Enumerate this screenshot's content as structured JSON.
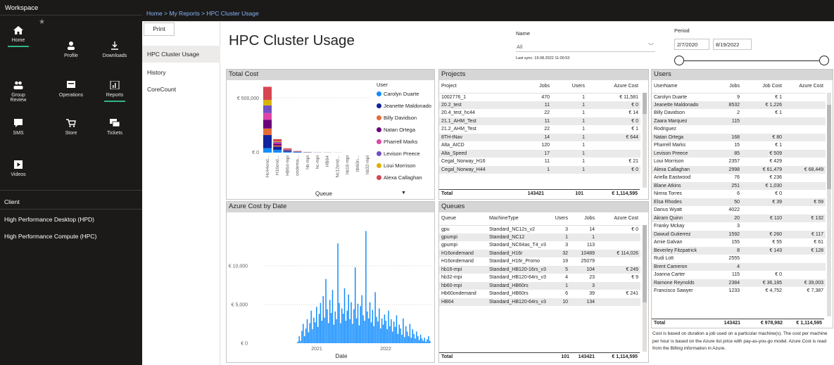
{
  "rail": {
    "workspace_title": "Workspace",
    "nav": [
      {
        "label": "Home",
        "icon": "home-icon"
      },
      {
        "label": "Profile",
        "icon": "person-icon"
      },
      {
        "label": "Downloads",
        "icon": "download-icon"
      },
      {
        "label": "Group Review",
        "icon": "group-icon"
      },
      {
        "label": "Operations",
        "icon": "operations-icon"
      },
      {
        "label": "Reports",
        "icon": "report-icon"
      },
      {
        "label": "SMS",
        "icon": "sms-icon"
      },
      {
        "label": "Store",
        "icon": "cart-icon"
      },
      {
        "label": "Tickets",
        "icon": "ticket-icon"
      },
      {
        "label": "Videos",
        "icon": "video-icon"
      }
    ],
    "section_label": "Client",
    "links": [
      "High Performance Desktop (HPD)",
      "High Performance Compute (HPC)"
    ]
  },
  "breadcrumb": "Home > My Reports > HPC Cluster Usage",
  "pages": {
    "print_label": "Print",
    "items": [
      "HPC Cluster Usage",
      "History",
      "CoreCount"
    ]
  },
  "report": {
    "title": "HPC Cluster Usage",
    "name_label": "Name",
    "name_value": "All",
    "last_sync": "Last sync: 19.08.2022 11:00:53",
    "period_label": "Period",
    "period_start": "2/7/2020",
    "period_end": "8/19/2022"
  },
  "total_cost": {
    "title": "Total Cost",
    "legend_title": "User",
    "legend": [
      {
        "name": "Carolyn Duarte",
        "color": "#118dff"
      },
      {
        "name": "Jeanette Maldonado",
        "color": "#12239e"
      },
      {
        "name": "Billy Davidson",
        "color": "#e66c37"
      },
      {
        "name": "Natan Ortega",
        "color": "#6b007b"
      },
      {
        "name": "Pharrell Marks",
        "color": "#e044a7"
      },
      {
        "name": "Levison Preece",
        "color": "#744ec2"
      },
      {
        "name": "Loui Morrison",
        "color": "#d9b300"
      },
      {
        "name": "Alexa Callaghan",
        "color": "#d64550"
      }
    ],
    "xlabel": "Queue",
    "ytick_top": "€ 500,000",
    "ytick_zero": "€ 0"
  },
  "azure_by_date": {
    "title": "Azure Cost by Date",
    "xlabel": "Date",
    "yticks": [
      "€ 10,000",
      "€ 5,000",
      "€ 0"
    ],
    "xticks": [
      "2021",
      "2022"
    ]
  },
  "projects": {
    "title": "Projects",
    "headers": [
      "Project",
      "Jobs",
      "Users",
      "Azure Cost"
    ],
    "rows": [
      [
        "1002776_1",
        "470",
        "1",
        "€ 11,581"
      ],
      [
        "20.2_test",
        "11",
        "1",
        "€ 0"
      ],
      [
        "20.4_test_hc44",
        "22",
        "1",
        "€ 14"
      ],
      [
        "21.1_AHM_Test",
        "11",
        "1",
        "€ 0"
      ],
      [
        "21.2_AHM_Test",
        "22",
        "1",
        "€ 1"
      ],
      [
        "8TH-tNav",
        "14",
        "1",
        "€ 644"
      ],
      [
        "Alta_AICD",
        "120",
        "1",
        ""
      ],
      [
        "Alta_Speed",
        "17",
        "1",
        ""
      ],
      [
        "Cegal_Norway_H16",
        "11",
        "1",
        "€ 21"
      ],
      [
        "Cegal_Norway_H44",
        "1",
        "1",
        "€ 0"
      ]
    ],
    "total": [
      "Total",
      "143421",
      "101",
      "€ 1,114,595"
    ]
  },
  "queues": {
    "title": "Queues",
    "headers": [
      "Queue",
      "MachineType",
      "Users",
      "Jobs",
      "Azure Cost"
    ],
    "rows": [
      [
        "gpu",
        "Standard_NC12s_v2",
        "3",
        "14",
        "€ 0"
      ],
      [
        "gpumpi",
        "Standard_NC12",
        "1",
        "1",
        ""
      ],
      [
        "gpumpi",
        "Standard_NC64as_T4_v3",
        "3",
        "113",
        ""
      ],
      [
        "H16ondemand",
        "Standard_H16r",
        "32",
        "10489",
        "€ 114,026"
      ],
      [
        "H16ondemand",
        "Standard_H16r_Promo",
        "19",
        "25079",
        ""
      ],
      [
        "hb16-mpi",
        "Standard_HB120-16rs_v3",
        "5",
        "104",
        "€ 249"
      ],
      [
        "hb32-mpi",
        "Standard_HB120-64rs_v3",
        "4",
        "23",
        "€ 9"
      ],
      [
        "hb60-mpi",
        "Standard_HB60rs",
        "1",
        "3",
        ""
      ],
      [
        "Hb60ondemand",
        "Standard_HB60rs",
        "6",
        "39",
        "€ 241"
      ],
      [
        "HB64",
        "Standard_HB120-64rs_v3",
        "10",
        "134",
        ""
      ]
    ],
    "total": [
      "Total",
      "101",
      "143421",
      "€ 1,114,595"
    ]
  },
  "users": {
    "title": "Users",
    "headers": [
      "UserName",
      "Jobs",
      "Job Cost",
      "Azure Cost"
    ],
    "rows": [
      [
        "Carolyn Duarte",
        "9",
        "€ 1",
        ""
      ],
      [
        "Jeanette Maldonado",
        "8532",
        "€ 1,226",
        ""
      ],
      [
        "Billy Davidson",
        "2",
        "€ 1",
        ""
      ],
      [
        "Zaara Marquez",
        "115",
        "",
        ""
      ],
      [
        "Rodriguez",
        "",
        "",
        ""
      ],
      [
        "Natan Ortega",
        "168",
        "€ 80",
        ""
      ],
      [
        "Pharrell Marks",
        "15",
        "€ 1",
        ""
      ],
      [
        "Levison Preece",
        "85",
        "€ 509",
        ""
      ],
      [
        "Loui Morrison",
        "2357",
        "€ 429",
        ""
      ],
      [
        "Alexa Callaghan",
        "2998",
        "€ 61,479",
        "€ 68,449"
      ],
      [
        "Ariella Eastwood",
        "76",
        "€ 236",
        ""
      ],
      [
        "Blane Atkins",
        "251",
        "€ 1,030",
        ""
      ],
      [
        "Nimra Torres",
        "6",
        "€ 0",
        ""
      ],
      [
        "Elsa Rhodes",
        "50",
        "€ 39",
        "€ 59"
      ],
      [
        "Darius Wyatt",
        "4022",
        "",
        ""
      ],
      [
        "Akram Quinn",
        "20",
        "€ 110",
        "€ 132"
      ],
      [
        "Franky Mckay",
        "3",
        "",
        ""
      ],
      [
        "Dawud Gutierrez",
        "1592",
        "€ 260",
        "€ 117"
      ],
      [
        "Arnie Galvan",
        "155",
        "€ 55",
        "€ 61"
      ],
      [
        "Beverley Fitzpatrick",
        "8",
        "€ 143",
        "€ 128"
      ],
      [
        "Rudi Lott",
        "2555",
        "",
        ""
      ],
      [
        "Brent Cameron",
        "4",
        "",
        ""
      ],
      [
        "Joanna Carter",
        "115",
        "€ 0",
        ""
      ],
      [
        "Ramone Reynolds",
        "2384",
        "€ 36,185",
        "€ 39,003"
      ],
      [
        "Francisco Sawyer",
        "1233",
        "€ 4,752",
        "€ 7,387"
      ]
    ],
    "total": [
      "Total",
      "143421",
      "€ 978,982",
      "€ 1,114,595"
    ]
  },
  "footnote": "Cost is based on duration a job used on a particular machine(s). The cost per machine per hour is based on the Azure list price with pay-as-you-go model. Azure Cost is read from the Billing information in Azure.",
  "chart_data": [
    {
      "type": "bar",
      "title": "Total Cost",
      "xlabel": "Queue",
      "ylabel": "",
      "ylim": [
        0,
        700000
      ],
      "legend_title": "User",
      "legend_position": "right",
      "categories": [
        "Hc44ond...",
        "H16ond...",
        "HB64-mpi",
        "ondema...",
        "hb-mpi",
        "hc-mpi",
        "HB64",
        "Nc12ond...",
        "hb16-mpi",
        "hb60n...",
        "hb32-mpi"
      ],
      "series": [
        {
          "name": "Carolyn Duarte",
          "color": "#118dff",
          "values": [
            40000,
            25000,
            8000,
            4000,
            2000,
            0,
            1000,
            0,
            0,
            0,
            0
          ]
        },
        {
          "name": "Jeanette Maldonado",
          "color": "#12239e",
          "values": [
            120000,
            30000,
            10000,
            4000,
            1000,
            1000,
            0,
            0,
            0,
            0,
            0
          ]
        },
        {
          "name": "Billy Davidson",
          "color": "#e66c37",
          "values": [
            60000,
            10000,
            5000,
            2000,
            1000,
            0,
            0,
            0,
            0,
            0,
            0
          ]
        },
        {
          "name": "Natan Ortega",
          "color": "#6b007b",
          "values": [
            80000,
            15000,
            4000,
            1000,
            0,
            0,
            0,
            0,
            0,
            0,
            0
          ]
        },
        {
          "name": "Pharrell Marks",
          "color": "#e044a7",
          "values": [
            60000,
            10000,
            3000,
            1000,
            0,
            1000,
            0,
            0,
            0,
            0,
            0
          ]
        },
        {
          "name": "Levison Preece",
          "color": "#744ec2",
          "values": [
            70000,
            8000,
            2000,
            1000,
            0,
            0,
            0,
            0,
            0,
            0,
            0
          ]
        },
        {
          "name": "Loui Morrison",
          "color": "#d9b300",
          "values": [
            50000,
            5000,
            2000,
            0,
            0,
            0,
            0,
            0,
            0,
            0,
            0
          ]
        },
        {
          "name": "Alexa Callaghan",
          "color": "#d64550",
          "values": [
            120000,
            20000,
            6000,
            2000,
            1000,
            0,
            1000,
            1000,
            0,
            0,
            0
          ]
        }
      ],
      "yticks": [
        "€ 500,000",
        "€ 0"
      ]
    },
    {
      "type": "bar",
      "title": "Azure Cost by Date",
      "xlabel": "Date",
      "ylabel": "",
      "ylim": [
        0,
        16000
      ],
      "yticks": [
        "€ 10,000",
        "€ 5,000",
        "€ 0"
      ],
      "xticks": [
        "2021",
        "2022"
      ],
      "x_range": [
        "2020-02-07",
        "2022-08-19"
      ],
      "series": [
        {
          "name": "",
          "color": "#118dff",
          "values": [
            0,
            0,
            0,
            0,
            0,
            0,
            0,
            0,
            0,
            0,
            0,
            0,
            0,
            0,
            0,
            0,
            0,
            0,
            0,
            0,
            0,
            0,
            0,
            0,
            200,
            900,
            300,
            1600,
            2500,
            900,
            1900,
            3100,
            1400,
            2600,
            4200,
            1800,
            3300,
            2700,
            4700,
            2100,
            3800,
            5200,
            2900,
            6100,
            3300,
            8300,
            4400,
            2600,
            5600,
            3900,
            6900,
            2400,
            4100,
            3100,
            12900,
            5200,
            2600,
            4500,
            3800,
            7100,
            2900,
            4200,
            6300,
            3100,
            5300,
            2500,
            4400,
            9800,
            3200,
            5100,
            2300,
            4800,
            6200,
            3600,
            2900,
            14500,
            4100,
            3200,
            5300,
            2700,
            4300,
            2200,
            6600,
            3400,
            2800,
            4500,
            1900,
            3200,
            2400,
            3700,
            2900,
            1800,
            4200,
            2200,
            3100,
            1500,
            2800,
            2100,
            3600,
            1200,
            2400,
            1900,
            1100,
            3200,
            800,
            2200,
            1500,
            900,
            2500,
            700,
            1800,
            1200,
            600,
            1500,
            900,
            400,
            1100,
            600,
            300,
            700,
            200,
            500,
            900,
            300
          ]
        }
      ]
    }
  ]
}
